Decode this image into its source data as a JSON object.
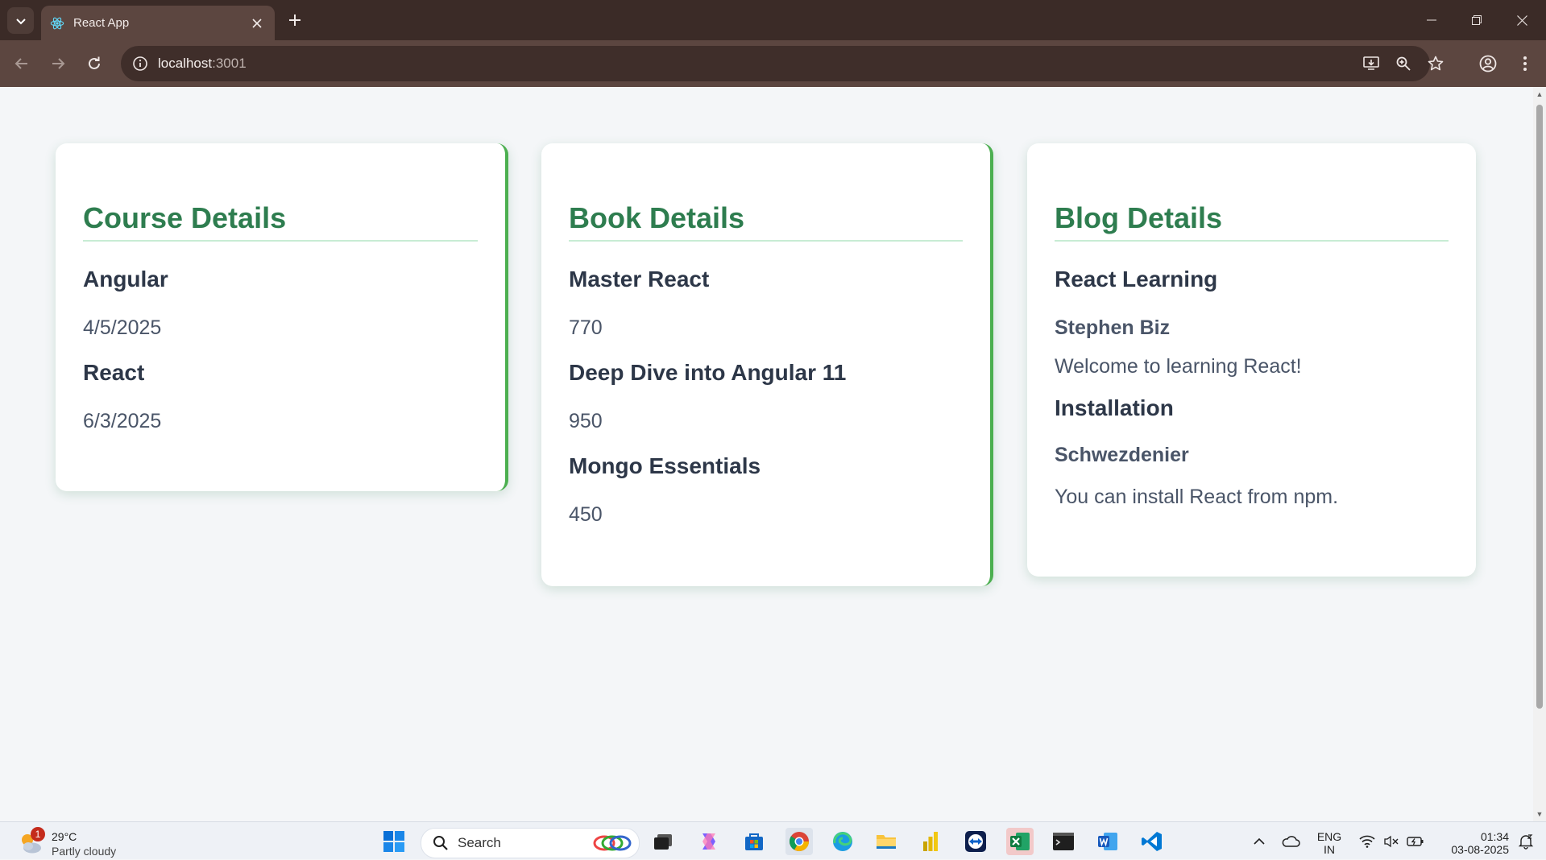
{
  "browser": {
    "tab_title": "React App",
    "url_host": "localhost",
    "url_port": ":3001"
  },
  "cards": {
    "course": {
      "heading": "Course Details",
      "items": [
        {
          "name": "Angular",
          "date": "4/5/2025"
        },
        {
          "name": "React",
          "date": "6/3/2025"
        }
      ]
    },
    "book": {
      "heading": "Book Details",
      "items": [
        {
          "name": "Master React",
          "price": "770"
        },
        {
          "name": "Deep Dive into Angular 11",
          "price": "950"
        },
        {
          "name": "Mongo Essentials",
          "price": "450"
        }
      ]
    },
    "blog": {
      "heading": "Blog Details",
      "items": [
        {
          "title": "React Learning",
          "author": "Stephen Biz",
          "content": "Welcome to learning React!"
        },
        {
          "title": "Installation",
          "author": "Schwezdenier",
          "content": "You can install React from npm."
        }
      ]
    }
  },
  "taskbar": {
    "weather_badge": "1",
    "weather_temp": "29°C",
    "weather_condition": "Partly cloudy",
    "search_label": "Search",
    "lang_line1": "ENG",
    "lang_line2": "IN",
    "time": "01:34",
    "date": "03-08-2025"
  },
  "colors": {
    "accent_green": "#2e7d4f",
    "card_border": "#4caf50",
    "chrome_dark": "#3b2b27",
    "chrome_toolbar": "#5c4640"
  }
}
